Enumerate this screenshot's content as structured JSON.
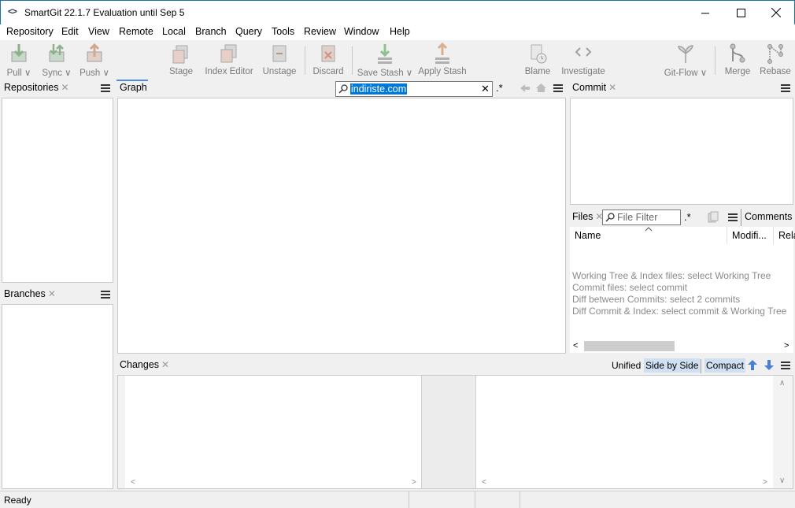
{
  "window": {
    "title": "SmartGit 22.1.7 Evaluation until Sep 5",
    "app_icon": "<>"
  },
  "menu": [
    "Repository",
    "Edit",
    "View",
    "Remote",
    "Local",
    "Branch",
    "Query",
    "Tools",
    "Review",
    "Window",
    "Help"
  ],
  "toolbar": {
    "pull": "Pull ∨",
    "sync": "Sync ∨",
    "push": "Push ∨",
    "stage": "Stage",
    "index_editor": "Index Editor",
    "unstage": "Unstage",
    "discard": "Discard",
    "save_stash": "Save Stash ∨",
    "apply_stash": "Apply Stash",
    "blame": "Blame",
    "investigate": "Investigate",
    "git_flow": "Git-Flow ∨",
    "merge": "Merge",
    "rebase": "Rebase"
  },
  "panels": {
    "repositories": "Repositories",
    "branches": "Branches",
    "graph": "Graph",
    "commit": "Commit",
    "files": "Files",
    "comments": "Comments",
    "changes": "Changes"
  },
  "graph_search": {
    "value": "indiriste.com",
    "regex": ".*"
  },
  "files": {
    "filter_placeholder": "File Filter",
    "regex": ".*",
    "columns": [
      "Name",
      "Modifi...",
      "Rela"
    ],
    "hints": [
      "Working Tree & Index files: select Working Tree",
      "Commit files: select commit",
      "Diff between Commits: select 2 commits",
      "Diff Commit & Index: select commit & Working Tree"
    ]
  },
  "changes": {
    "unified": "Unified",
    "side_by_side": "Side by Side",
    "compact": "Compact"
  },
  "status": {
    "text": "Ready"
  }
}
